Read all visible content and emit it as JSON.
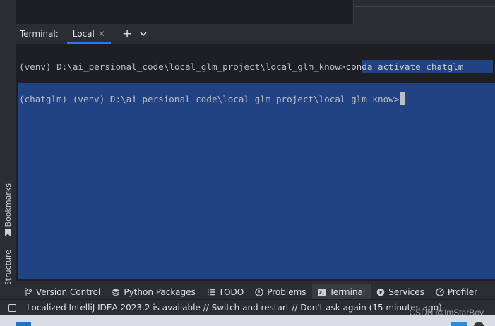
{
  "terminal": {
    "title": "Terminal:",
    "tab_label": "Local",
    "lines": [
      {
        "prompt": "(venv) D:\\ai_persional_code\\local_glm_project\\local_glm_know>",
        "command": "conda activate chatglm"
      },
      {
        "prompt": "(chatglm) (venv) D:\\ai_persional_code\\local_glm_project\\local_glm_know>",
        "command": ""
      }
    ]
  },
  "left_tools": {
    "bookmarks": "Bookmarks",
    "structure": "Structure"
  },
  "tool_windows": [
    {
      "label": "Version Control",
      "icon": "branch-icon"
    },
    {
      "label": "Python Packages",
      "icon": "layers-icon"
    },
    {
      "label": "TODO",
      "icon": "list-icon"
    },
    {
      "label": "Problems",
      "icon": "warning-circle-icon"
    },
    {
      "label": "Terminal",
      "icon": "terminal-icon"
    },
    {
      "label": "Services",
      "icon": "play-circle-icon"
    },
    {
      "label": "Profiler",
      "icon": "gauge-icon"
    }
  ],
  "status": {
    "message": "Localized IntelliJ IDEA 2023.2 is available // Switch and restart // Don't ask again (15 minutes ago)",
    "watermark": "CSDN @ImStarBoy"
  },
  "colors": {
    "selection": "#214283",
    "accent": "#3574f0",
    "terminal_bg": "#1e1f22"
  }
}
